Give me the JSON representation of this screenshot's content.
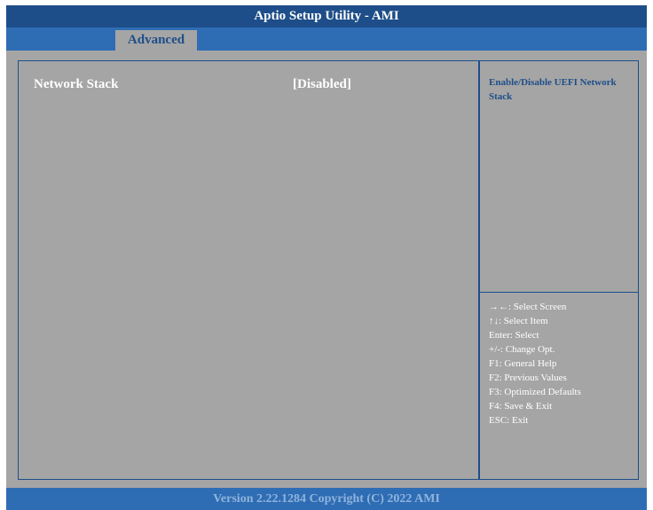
{
  "title": "Aptio Setup Utility - AMI",
  "tabs": [
    {
      "label": "Advanced",
      "active": true
    }
  ],
  "settings": [
    {
      "label": "Network Stack",
      "value": "[Disabled]"
    }
  ],
  "help": {
    "text": "Enable/Disable UEFI Network Stack"
  },
  "keys": [
    "→←: Select Screen",
    "↑↓: Select Item",
    "Enter: Select",
    "+/-: Change Opt.",
    "F1: General Help",
    "F2: Previous Values",
    "F3: Optimized Defaults",
    "F4: Save & Exit",
    "ESC: Exit"
  ],
  "footer": "Version 2.22.1284 Copyright (C) 2022 AMI",
  "colors": {
    "title_bg": "#1d4e89",
    "tab_bar_bg": "#2e6db4",
    "panel_bg": "#a5a5a5",
    "help_text": "#1d4e89",
    "text": "#ffffff"
  }
}
